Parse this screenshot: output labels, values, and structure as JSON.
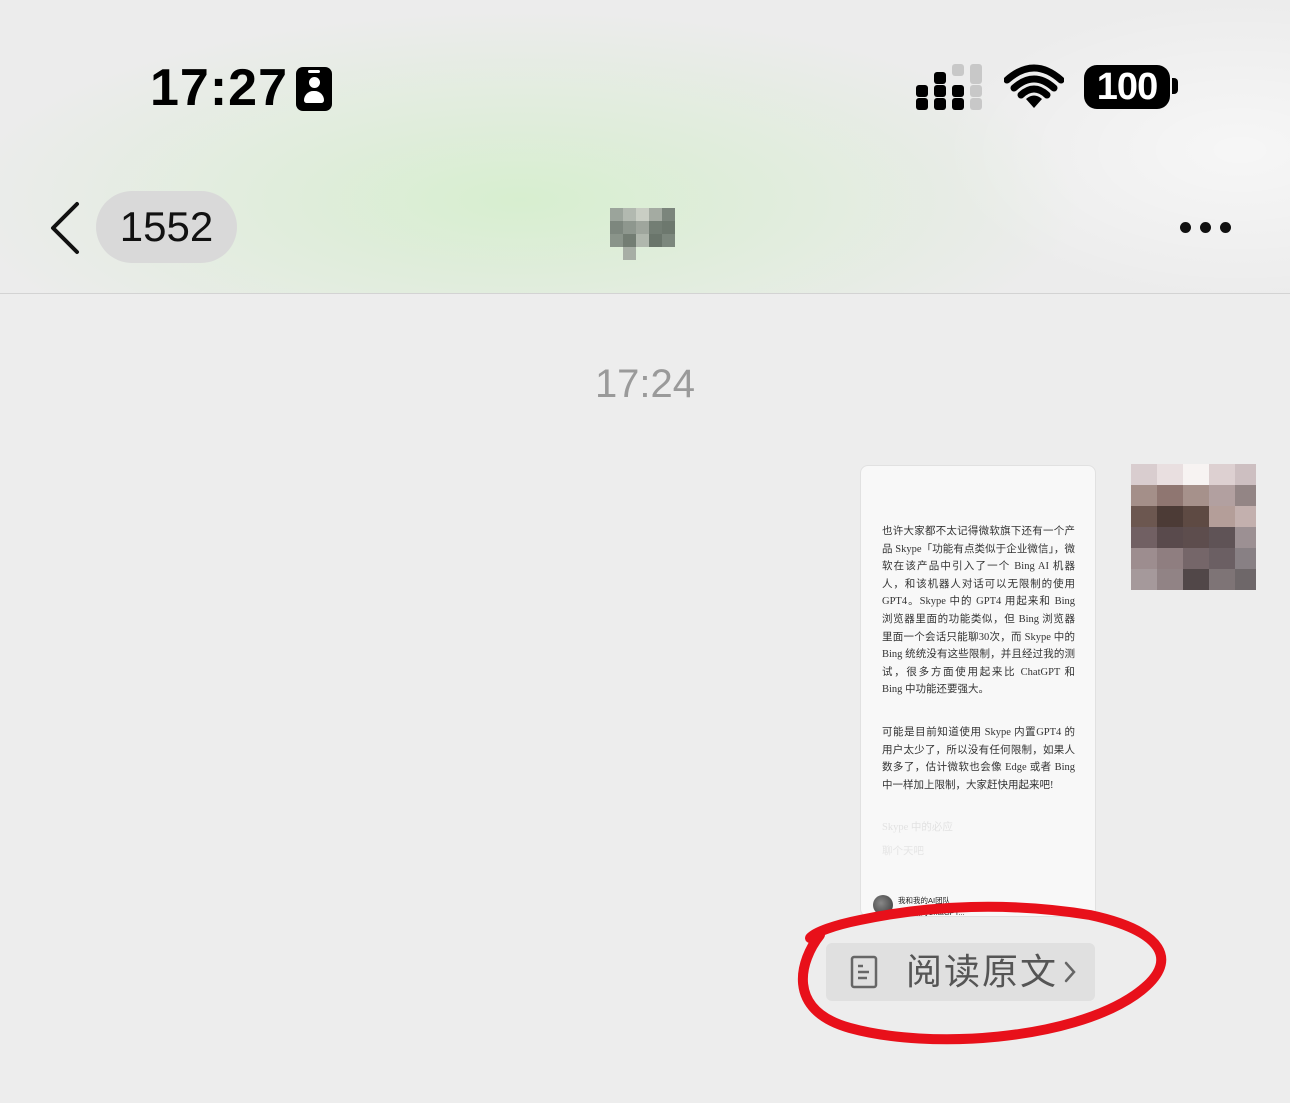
{
  "status_bar": {
    "time": "17:27",
    "battery": "100",
    "icons": [
      "id-badge-icon",
      "signal-icon",
      "wifi-icon",
      "battery-icon"
    ]
  },
  "nav": {
    "back_icon": "chevron-left-icon",
    "unread_count": "1552",
    "more_icon": "more-dots-icon"
  },
  "conversation": {
    "timestamp": "17:24"
  },
  "article_card": {
    "paragraph_1": "也许大家都不太记得微软旗下还有一个产品 Skype「功能有点类似于企业微信」，微软在该产品中引入了一个 Bing AI 机器人，和该机器人对话可以无限制的使用 GPT4。Skype 中的 GPT4 用起来和 Bing 浏览器里面的功能类似，但 Bing 浏览器里面一个会话只能聊30次，而 Skype 中的 Bing 统统没有这些限制，并且经过我的测试，很多方面使用起来比 ChatGPT 和 Bing 中功能还要强大。",
    "paragraph_2": "可能是目前知道使用 Skype 内置GPT4 的用户太少了，所以没有任何限制，如果人数多了，估计微软也会像 Edge 或者 Bing 中一样加上限制，大家赶快用起来吧!",
    "faded_1": "Skype 中的必应",
    "faded_2": "聊个天吧",
    "author_name": "我和我的AI团队",
    "author_sub": "免费版的ChatGPT..."
  },
  "read_original": {
    "label": "阅读原文",
    "icon": "document-icon",
    "chevron": "chevron-right-icon"
  },
  "colors": {
    "annotation_red": "#e8101a",
    "header_tint": "#d6eece",
    "background": "#ededed"
  }
}
